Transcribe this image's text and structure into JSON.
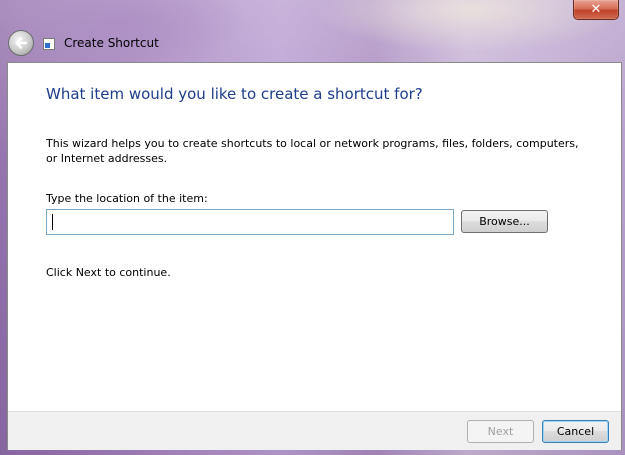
{
  "window": {
    "title": "Create Shortcut",
    "close_label": "✕"
  },
  "wizard": {
    "heading": "What item would you like to create a shortcut for?",
    "description": "This wizard helps you to create shortcuts to local or network programs, files, folders, computers, or Internet addresses.",
    "location_label": "Type the location of the item:",
    "location_value": "",
    "browse_label": "Browse...",
    "continue_text": "Click Next to continue."
  },
  "footer": {
    "next_label": "Next",
    "cancel_label": "Cancel"
  },
  "icons": {
    "back": "back-arrow-icon",
    "title": "shortcut-icon",
    "close": "close-icon"
  }
}
